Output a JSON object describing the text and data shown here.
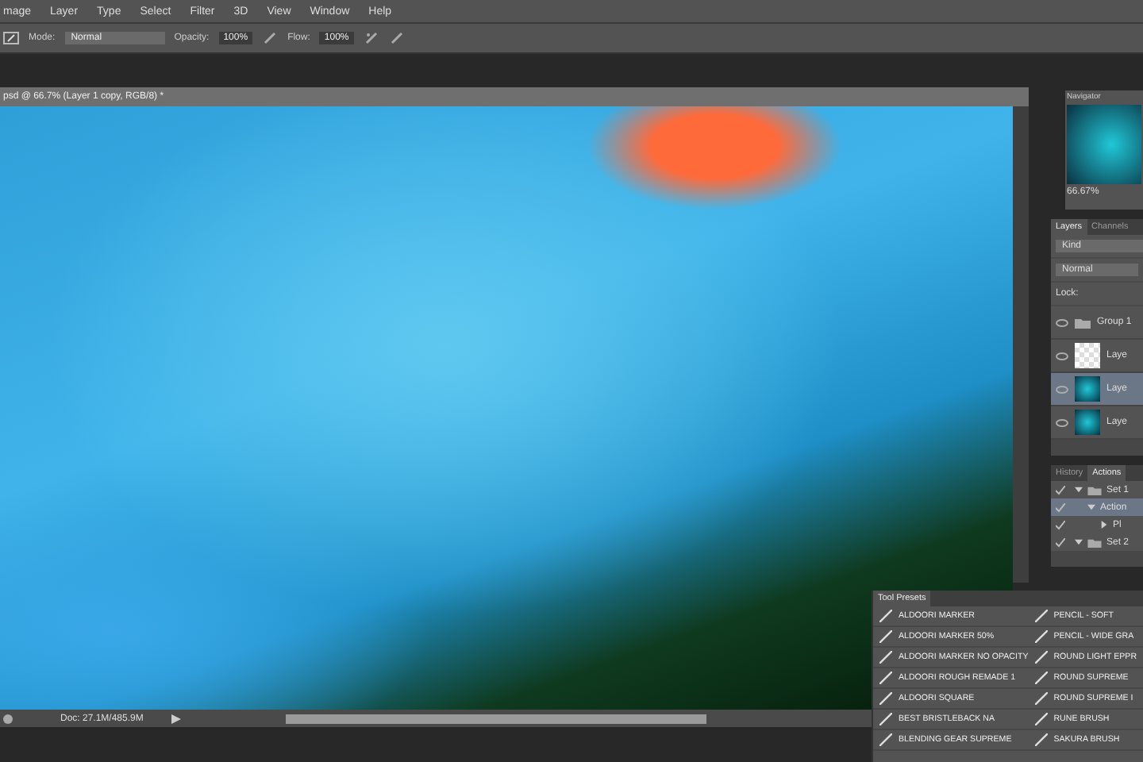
{
  "menu_bar": {
    "items": [
      "mage",
      "Layer",
      "Type",
      "Select",
      "Filter",
      "3D",
      "View",
      "Window",
      "Help"
    ]
  },
  "options_bar": {
    "mode_label": "Mode:",
    "mode": "Normal",
    "opacity_label": "Opacity:",
    "opacity": "100%",
    "flow_label": "Flow:",
    "flow": "100%"
  },
  "document": {
    "tab_title": "psd @ 66.7% (Layer 1 copy, RGB/8) *",
    "status": "Doc: 27.1M/485.9M"
  },
  "navigator": {
    "title": "Navigator",
    "zoom": "66.67%"
  },
  "layers_panel": {
    "tabs": [
      {
        "label": "Layers",
        "selected": true
      },
      {
        "label": "Channels",
        "selected": false
      }
    ],
    "filter": "Kind",
    "blend_mode": "Normal",
    "lock_label": "Lock:",
    "layers": [
      {
        "name": "Group 1",
        "kind": "group",
        "visible": true,
        "selected": false
      },
      {
        "name": "Laye",
        "kind": "blank",
        "visible": true,
        "selected": false
      },
      {
        "name": "Laye",
        "kind": "image",
        "visible": true,
        "selected": true
      },
      {
        "name": "Laye",
        "kind": "image",
        "visible": true,
        "selected": false
      }
    ]
  },
  "actions_panel": {
    "tabs": [
      {
        "label": "History",
        "selected": false
      },
      {
        "label": "Actions",
        "selected": true
      }
    ],
    "rows": [
      {
        "name": "Set 1",
        "kind": "set",
        "expanded": true,
        "checked": true,
        "children": [
          {
            "name": "Action",
            "expanded": true,
            "checked": true,
            "selected": true,
            "children": [
              {
                "name": "Pl",
                "expanded": false,
                "checked": true,
                "selected": false
              }
            ]
          }
        ]
      },
      {
        "name": "Set 2",
        "kind": "set",
        "expanded": true,
        "checked": true
      }
    ]
  },
  "tool_presets": {
    "title": "Tool Presets",
    "column_1": [
      "ALDOORI MARKER",
      "ALDOORI MARKER 50%",
      "ALDOORI MARKER NO OPACITY",
      "ALDOORI ROUGH REMADE 1",
      "ALDOORI SQUARE",
      "BEST BRISTLEBACK NA",
      "BLENDING GEAR SUPREME"
    ],
    "column_2": [
      "PENCIL - SOFT",
      "PENCIL - WIDE GRA",
      "ROUND LIGHT EPPR",
      "ROUND SUPREME",
      "ROUND SUPREME I",
      "RUNE BRUSH",
      "SAKURA BRUSH"
    ]
  }
}
